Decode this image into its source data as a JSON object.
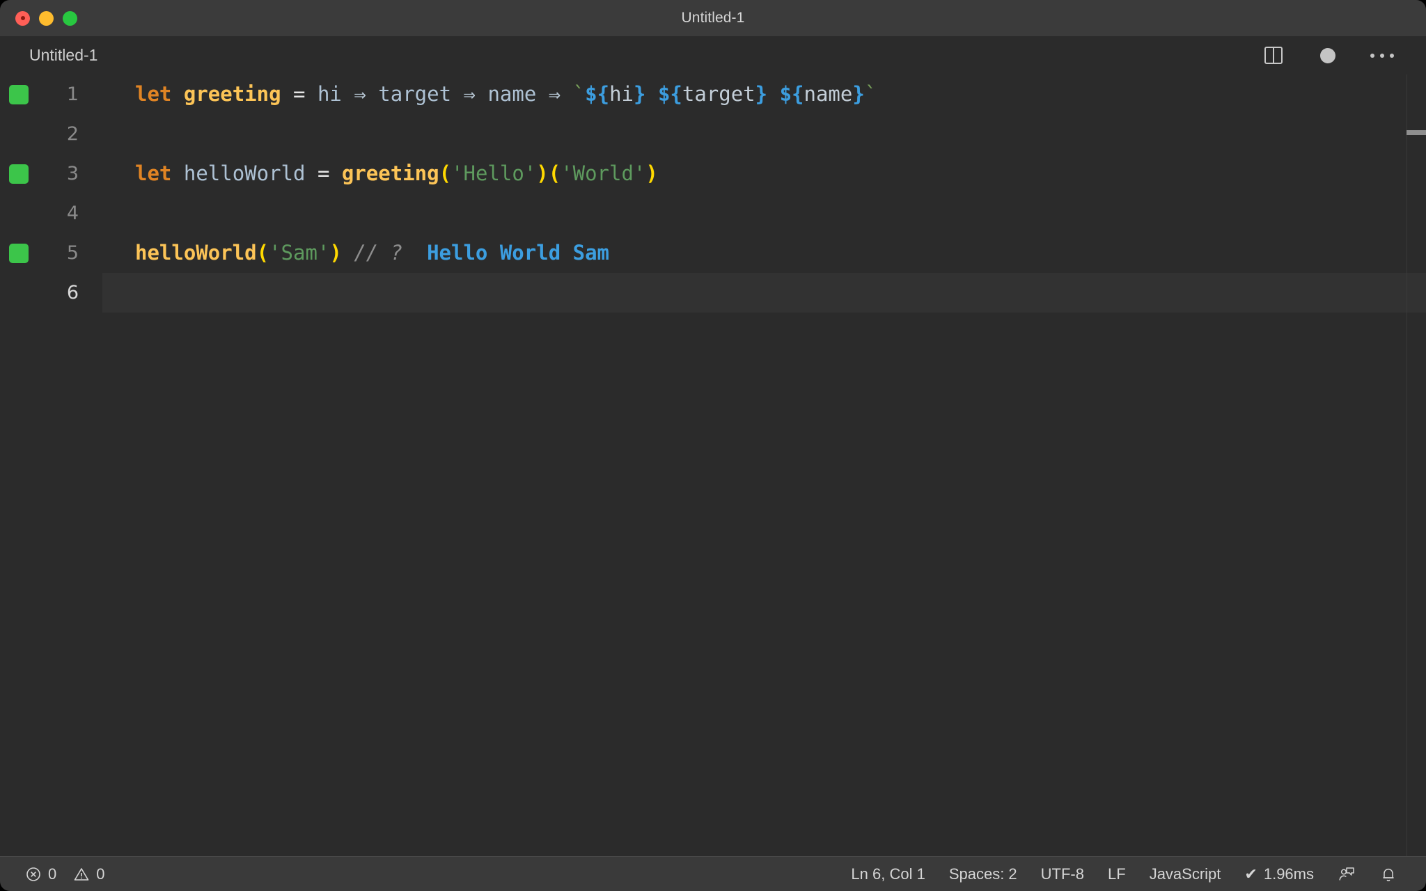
{
  "window": {
    "title": "Untitled-1",
    "traffic_lights": [
      "close-button",
      "minimize-button",
      "maximize-button"
    ]
  },
  "tabbar": {
    "active_tab": "Untitled-1",
    "actions": [
      {
        "name": "split-editor-icon",
        "label": "Split Editor"
      },
      {
        "name": "unsaved-dot-icon",
        "label": "Unsaved changes"
      },
      {
        "name": "more-actions-icon",
        "label": "More Actions..."
      }
    ]
  },
  "editor": {
    "language": "JavaScript",
    "active_line": 6,
    "lines": [
      {
        "number": "1",
        "coverage": true,
        "active": false,
        "tokens": [
          {
            "cls": "t-kw",
            "text": "let"
          },
          {
            "cls": "t-plain",
            "text": " "
          },
          {
            "cls": "t-fn",
            "text": "greeting"
          },
          {
            "cls": "t-plain",
            "text": " "
          },
          {
            "cls": "t-op",
            "text": "="
          },
          {
            "cls": "t-plain",
            "text": " "
          },
          {
            "cls": "t-var",
            "text": "hi"
          },
          {
            "cls": "t-plain",
            "text": " "
          },
          {
            "cls": "t-arrow",
            "text": "⇒"
          },
          {
            "cls": "t-plain",
            "text": " "
          },
          {
            "cls": "t-var",
            "text": "target"
          },
          {
            "cls": "t-plain",
            "text": " "
          },
          {
            "cls": "t-arrow",
            "text": "⇒"
          },
          {
            "cls": "t-plain",
            "text": " "
          },
          {
            "cls": "t-var",
            "text": "name"
          },
          {
            "cls": "t-plain",
            "text": " "
          },
          {
            "cls": "t-arrow",
            "text": "⇒"
          },
          {
            "cls": "t-plain",
            "text": " "
          },
          {
            "cls": "t-tick",
            "text": "`"
          },
          {
            "cls": "t-interp",
            "text": "${"
          },
          {
            "cls": "t-ident",
            "text": "hi"
          },
          {
            "cls": "t-interp",
            "text": "}"
          },
          {
            "cls": "t-ident",
            "text": " "
          },
          {
            "cls": "t-interp",
            "text": "${"
          },
          {
            "cls": "t-ident",
            "text": "target"
          },
          {
            "cls": "t-interp",
            "text": "}"
          },
          {
            "cls": "t-ident",
            "text": " "
          },
          {
            "cls": "t-interp",
            "text": "${"
          },
          {
            "cls": "t-ident",
            "text": "name"
          },
          {
            "cls": "t-interp",
            "text": "}"
          },
          {
            "cls": "t-tick",
            "text": "`"
          }
        ]
      },
      {
        "number": "2",
        "coverage": false,
        "active": false,
        "tokens": []
      },
      {
        "number": "3",
        "coverage": true,
        "active": false,
        "tokens": [
          {
            "cls": "t-kw",
            "text": "let"
          },
          {
            "cls": "t-plain",
            "text": " "
          },
          {
            "cls": "t-var",
            "text": "helloWorld"
          },
          {
            "cls": "t-plain",
            "text": " "
          },
          {
            "cls": "t-op",
            "text": "="
          },
          {
            "cls": "t-plain",
            "text": " "
          },
          {
            "cls": "t-fn",
            "text": "greeting"
          },
          {
            "cls": "t-paren",
            "text": "("
          },
          {
            "cls": "t-str",
            "text": "'Hello'"
          },
          {
            "cls": "t-paren",
            "text": ")("
          },
          {
            "cls": "t-str",
            "text": "'World'"
          },
          {
            "cls": "t-paren",
            "text": ")"
          }
        ]
      },
      {
        "number": "4",
        "coverage": false,
        "active": false,
        "tokens": []
      },
      {
        "number": "5",
        "coverage": true,
        "active": false,
        "tokens": [
          {
            "cls": "t-fn",
            "text": "helloWorld"
          },
          {
            "cls": "t-paren",
            "text": "("
          },
          {
            "cls": "t-str",
            "text": "'Sam'"
          },
          {
            "cls": "t-paren",
            "text": ")"
          },
          {
            "cls": "t-plain",
            "text": " "
          },
          {
            "cls": "t-comment",
            "text": "// ?"
          },
          {
            "cls": "t-plain",
            "text": "  "
          },
          {
            "cls": "t-output",
            "text": "Hello World Sam"
          }
        ]
      },
      {
        "number": "6",
        "coverage": false,
        "active": true,
        "tokens": []
      }
    ]
  },
  "statusbar": {
    "errors": "0",
    "warnings": "0",
    "cursor": "Ln 6, Col 1",
    "indentation": "Spaces: 2",
    "encoding": "UTF-8",
    "eol": "LF",
    "language": "JavaScript",
    "runtime": "1.96ms",
    "runtime_check": "✔",
    "remote_icon": "person-feedback-icon",
    "bell_icon": "notifications-bell-icon"
  }
}
